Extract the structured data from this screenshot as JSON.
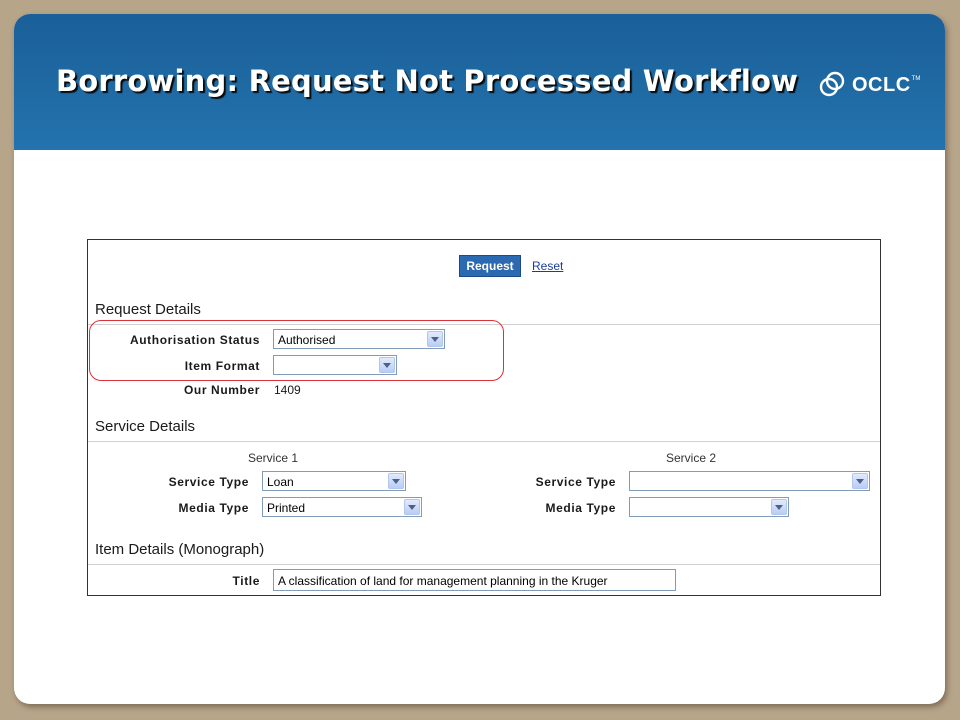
{
  "slide": {
    "title": "Borrowing: Request Not Processed Workflow",
    "logo_text": "OCLC",
    "logo_tm": "TM"
  },
  "toolbar": {
    "request_label": "Request",
    "reset_label": "Reset"
  },
  "request_details": {
    "heading": "Request Details",
    "authorisation_status": {
      "label": "Authorisation Status",
      "value": "Authorised"
    },
    "item_format": {
      "label": "Item Format",
      "value": ""
    },
    "our_number": {
      "label": "Our Number",
      "value": "1409"
    }
  },
  "service_details": {
    "heading": "Service Details",
    "service1": {
      "heading": "Service 1",
      "service_type": {
        "label": "Service Type",
        "value": "Loan"
      },
      "media_type": {
        "label": "Media Type",
        "value": "Printed"
      }
    },
    "service2": {
      "heading": "Service 2",
      "service_type": {
        "label": "Service Type",
        "value": ""
      },
      "media_type": {
        "label": "Media Type",
        "value": ""
      }
    }
  },
  "item_details": {
    "heading": "Item Details (Monograph)",
    "title": {
      "label": "Title",
      "value": "A classification of land for management planning in the Kruger"
    }
  },
  "colors": {
    "banner": "#2473ae",
    "button": "#2b6ab0",
    "highlight": "#d9323a",
    "frame": "#b7a58a"
  }
}
